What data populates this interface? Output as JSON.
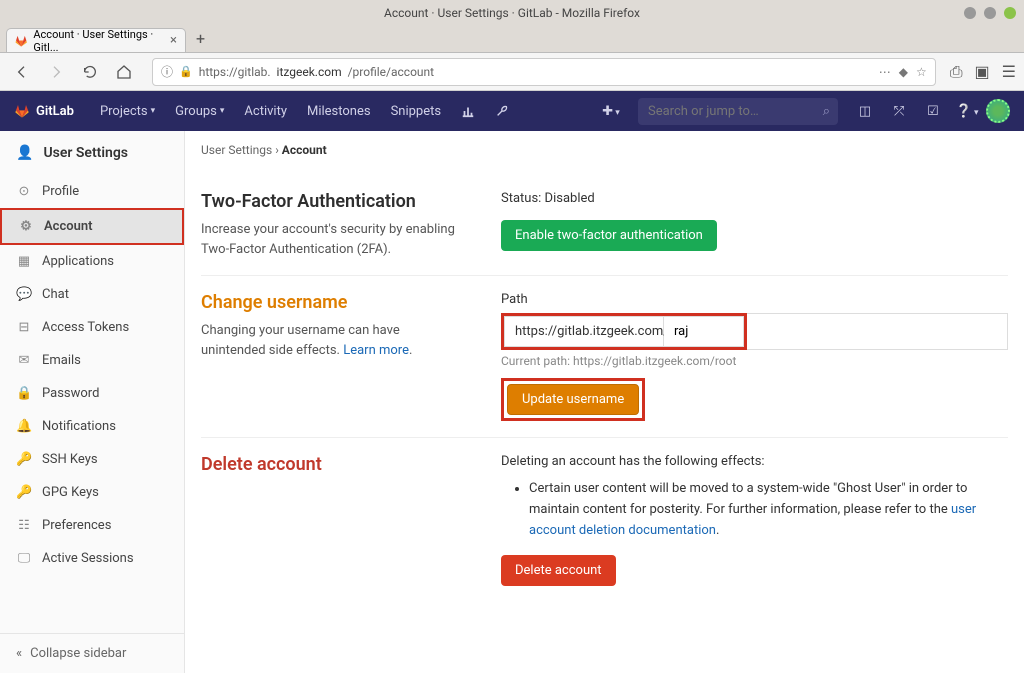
{
  "window": {
    "title": "Account · User Settings · GitLab - Mozilla Firefox"
  },
  "tab": {
    "label": "Account · User Settings · Gitl..."
  },
  "url": {
    "scheme_host": "https://gitlab.",
    "domain": "itzgeek.com",
    "path": "/profile/account"
  },
  "navbar": {
    "brand": "GitLab",
    "items": {
      "projects": "Projects",
      "groups": "Groups",
      "activity": "Activity",
      "milestones": "Milestones",
      "snippets": "Snippets"
    },
    "search_placeholder": "Search or jump to…"
  },
  "sidebar": {
    "header": "User Settings",
    "items": [
      {
        "label": "Profile"
      },
      {
        "label": "Account"
      },
      {
        "label": "Applications"
      },
      {
        "label": "Chat"
      },
      {
        "label": "Access Tokens"
      },
      {
        "label": "Emails"
      },
      {
        "label": "Password"
      },
      {
        "label": "Notifications"
      },
      {
        "label": "SSH Keys"
      },
      {
        "label": "GPG Keys"
      },
      {
        "label": "Preferences"
      },
      {
        "label": "Active Sessions"
      }
    ],
    "collapse": "Collapse sidebar"
  },
  "breadcrumb": {
    "a": "User Settings",
    "sep": "›",
    "b": "Account"
  },
  "twofa": {
    "heading": "Two-Factor Authentication",
    "desc": "Increase your account's security by enabling Two-Factor Authentication (2FA).",
    "status": "Status: Disabled",
    "button": "Enable two-factor authentication"
  },
  "changeuser": {
    "heading": "Change username",
    "desc": "Changing your username can have unintended side effects. ",
    "learn": "Learn more",
    "dot": ".",
    "path_label": "Path",
    "path_prefix": "https://gitlab.itzgeek.com/",
    "path_value": "raj",
    "current_path": "Current path: https://gitlab.itzgeek.com/root",
    "button": "Update username"
  },
  "deleteacc": {
    "heading": "Delete account",
    "intro": "Deleting an account has the following effects:",
    "bullet_a": "Certain user content will be moved to a system-wide \"Ghost User\" in order to maintain content for posterity. For further information, please refer to the ",
    "bullet_link": "user account deletion documentation",
    "bullet_b": ".",
    "button": "Delete account"
  }
}
